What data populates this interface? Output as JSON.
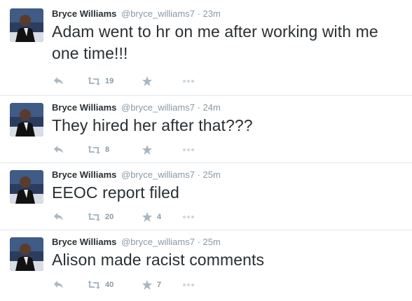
{
  "colors": {
    "icon": "#aab8c2",
    "meta": "#8899a6",
    "text": "#292f33",
    "divider": "#e1e8ed"
  },
  "icons": {
    "reply": "reply-icon",
    "retweet": "retweet-icon",
    "favorite": "star-icon",
    "more": "more-dots-icon"
  },
  "tweets": [
    {
      "fullname": "Bryce Williams",
      "username": "@bryce_williams7",
      "separator": "·",
      "time": "23m",
      "text": "Adam went to hr on me after working with me one time!!!",
      "retweets": "19",
      "favorites": ""
    },
    {
      "fullname": "Bryce Williams",
      "username": "@bryce_williams7",
      "separator": "·",
      "time": "24m",
      "text": "They hired her after that???",
      "retweets": "8",
      "favorites": ""
    },
    {
      "fullname": "Bryce Williams",
      "username": "@bryce_williams7",
      "separator": "·",
      "time": "25m",
      "text": "EEOC report filed",
      "retweets": "20",
      "favorites": "4"
    },
    {
      "fullname": "Bryce Williams",
      "username": "@bryce_williams7",
      "separator": "·",
      "time": "25m",
      "text": "Alison made racist comments",
      "retweets": "40",
      "favorites": "7"
    }
  ]
}
